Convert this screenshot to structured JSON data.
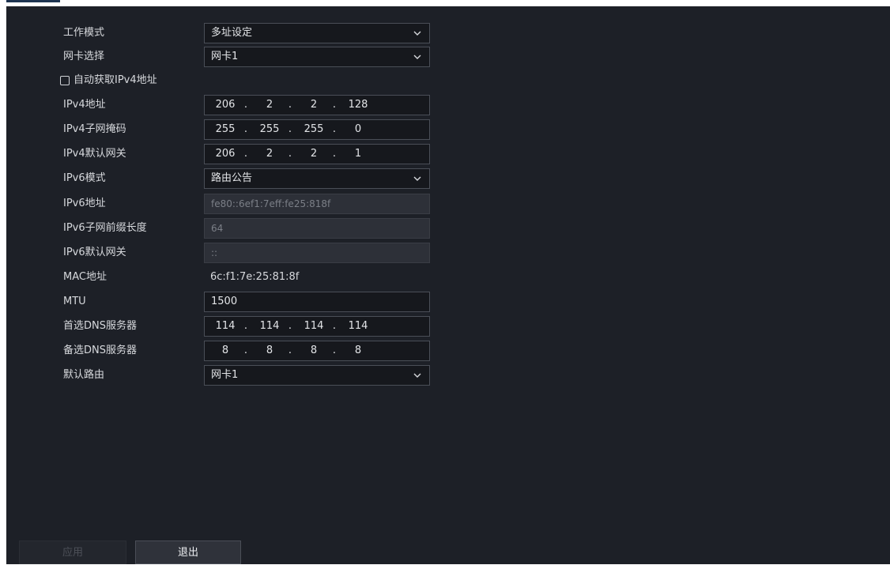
{
  "form": {
    "work_mode": {
      "label": "工作模式",
      "value": "多址设定"
    },
    "nic_select": {
      "label": "网卡选择",
      "value": "网卡1"
    },
    "auto_ipv4": {
      "label": "自动获取IPv4地址",
      "checked": false
    },
    "ipv4_address": {
      "label": "IPv4地址",
      "octets": [
        "206",
        "2",
        "2",
        "128"
      ]
    },
    "ipv4_mask": {
      "label": "IPv4子网掩码",
      "octets": [
        "255",
        "255",
        "255",
        "0"
      ]
    },
    "ipv4_gateway": {
      "label": "IPv4默认网关",
      "octets": [
        "206",
        "2",
        "2",
        "1"
      ]
    },
    "ipv6_mode": {
      "label": "IPv6模式",
      "value": "路由公告"
    },
    "ipv6_address": {
      "label": "IPv6地址",
      "value": "fe80::6ef1:7eff:fe25:818f"
    },
    "ipv6_prefix": {
      "label": "IPv6子网前缀长度",
      "value": "64"
    },
    "ipv6_gateway": {
      "label": "IPv6默认网关",
      "value": "::"
    },
    "mac": {
      "label": "MAC地址",
      "value": "6c:f1:7e:25:81:8f"
    },
    "mtu": {
      "label": "MTU",
      "value": "1500"
    },
    "dns_primary": {
      "label": "首选DNS服务器",
      "octets": [
        "114",
        "114",
        "114",
        "114"
      ]
    },
    "dns_secondary": {
      "label": "备选DNS服务器",
      "octets": [
        "8",
        "8",
        "8",
        "8"
      ]
    },
    "default_route": {
      "label": "默认路由",
      "value": "网卡1"
    }
  },
  "buttons": {
    "apply": {
      "label": "应用",
      "enabled": false
    },
    "exit": {
      "label": "退出",
      "enabled": true
    }
  },
  "ip_separator": ".",
  "icons": {
    "dropdown": "chevron-down-icon"
  },
  "colors": {
    "background": "#1d2027",
    "field_border": "#4a4e57",
    "field_bg": "#16181d",
    "readonly_bg": "#2d3038",
    "text": "#d7d9dd",
    "disabled_text": "#4d5058"
  }
}
